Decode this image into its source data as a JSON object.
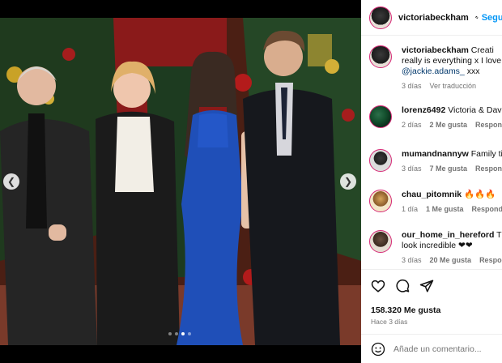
{
  "header": {
    "username": "victoriabeckham",
    "separator": "•",
    "follow_label": "Seguir"
  },
  "caption": {
    "username": "victoriabeckham",
    "text_line1": "Creati",
    "text_line2": "really is everything x I love",
    "mention": "@jackie.adams_",
    "suffix": "xxx",
    "time": "3 días",
    "translate_label": "Ver traducción"
  },
  "comments": [
    {
      "username": "lorenz6492",
      "text": "Victoria & Dav",
      "time": "2 días",
      "likes": "2 Me gusta",
      "reply": "Respond"
    },
    {
      "username": "mumandnannyw",
      "text": "Family ti",
      "time": "3 días",
      "likes": "7 Me gusta",
      "reply": "Respond"
    },
    {
      "username": "chau_pitomnik",
      "text": "🔥🔥🔥",
      "time": "1 día",
      "likes": "1 Me gusta",
      "reply": "Responde"
    },
    {
      "username": "our_home_in_hereford",
      "text": "Th",
      "text_line2": "look incredible ❤❤",
      "time": "3 días",
      "likes": "20 Me gusta",
      "reply": "Respon"
    }
  ],
  "likes_count": "158.320 Me gusta",
  "posted_ago": "Hace 3 días",
  "add_comment": {
    "placeholder": "Añade un comentario..."
  },
  "carousel": {
    "total": 4,
    "active_index": 2
  },
  "icons": [
    "heart-icon",
    "comment-icon",
    "share-icon",
    "emoji-icon",
    "chevron-left-icon",
    "chevron-right-icon",
    "verified-icon"
  ],
  "colors": {
    "accent": "#0095f6",
    "muted": "#737373",
    "mention": "#00376b",
    "like_heart": "#e11d48"
  }
}
